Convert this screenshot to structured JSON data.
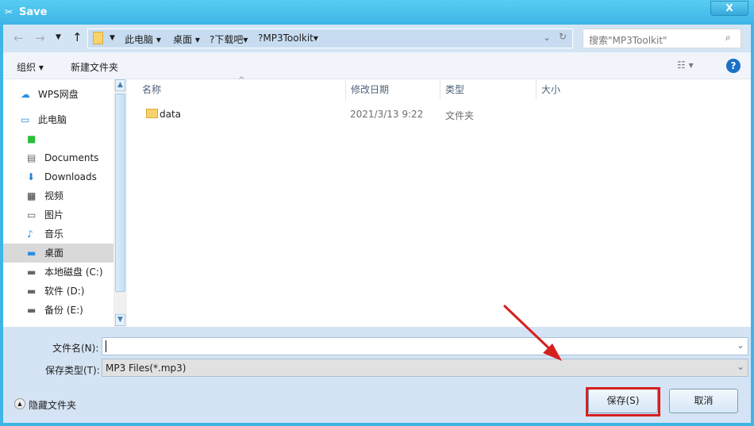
{
  "window": {
    "title": "Save",
    "close_label": "X"
  },
  "nav": {
    "breadcrumb": [
      "此电脑",
      "桌面",
      "?下载吧",
      "?MP3Toolkit"
    ],
    "search_placeholder": "搜索\"MP3Toolkit\""
  },
  "toolbar": {
    "organize": "组织",
    "new_folder": "新建文件夹"
  },
  "sidebar": {
    "items": [
      {
        "label": "WPS网盘",
        "icon": "cloud-icon"
      },
      {
        "label": "此电脑",
        "icon": "computer-icon"
      },
      {
        "label": "",
        "icon": "app-icon"
      },
      {
        "label": "Documents",
        "icon": "document-icon"
      },
      {
        "label": "Downloads",
        "icon": "download-icon"
      },
      {
        "label": "视频",
        "icon": "video-icon"
      },
      {
        "label": "图片",
        "icon": "picture-icon"
      },
      {
        "label": "音乐",
        "icon": "music-icon"
      },
      {
        "label": "桌面",
        "icon": "desktop-icon",
        "selected": true
      },
      {
        "label": "本地磁盘 (C:)",
        "icon": "drive-icon"
      },
      {
        "label": "软件 (D:)",
        "icon": "drive-icon"
      },
      {
        "label": "备份 (E:)",
        "icon": "drive-icon"
      }
    ]
  },
  "columns": [
    "名称",
    "修改日期",
    "类型",
    "大小"
  ],
  "files": [
    {
      "name": "data",
      "date": "2021/3/13 9:22",
      "type": "文件夹",
      "size": ""
    }
  ],
  "form": {
    "filename_label": "文件名(N):",
    "filename_value": "",
    "filetype_label": "保存类型(T):",
    "filetype_value": "MP3 Files(*.mp3)"
  },
  "footer": {
    "hide_folders": "隐藏文件夹",
    "save": "保存(S)",
    "cancel": "取消"
  },
  "colors": {
    "title_bar": "#3cb4e6",
    "highlight": "#d52020"
  }
}
